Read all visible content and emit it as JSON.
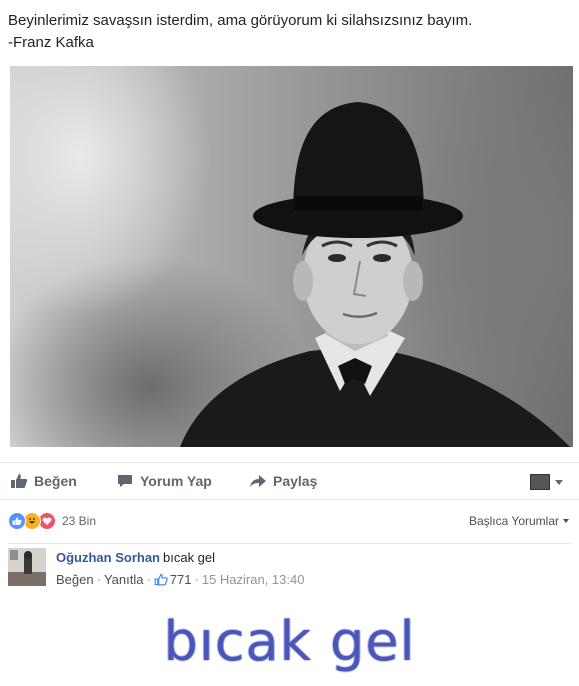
{
  "post": {
    "text_line1": "Beyinlerimiz savaşsın isterdim, ama görüyorum ki silahsızsınız bayım.",
    "text_line2": "-Franz Kafka"
  },
  "actions": {
    "like_label": "Beğen",
    "comment_label": "Yorum Yap",
    "share_label": "Paylaş"
  },
  "stats": {
    "reaction_count": "23 Bin",
    "sort_label": "Başlıca Yorumlar"
  },
  "comment": {
    "author": "Oğuzhan Sorhan",
    "text": "bıcak gel",
    "like_label": "Beğen",
    "reply_label": "Yanıtla",
    "like_count": "771",
    "timestamp": "15 Haziran, 13:40"
  },
  "caption": {
    "text": "bıcak gel"
  },
  "colors": {
    "link_blue": "#365899",
    "action_gray": "#606770",
    "caption_blue": "#4a56b8"
  }
}
